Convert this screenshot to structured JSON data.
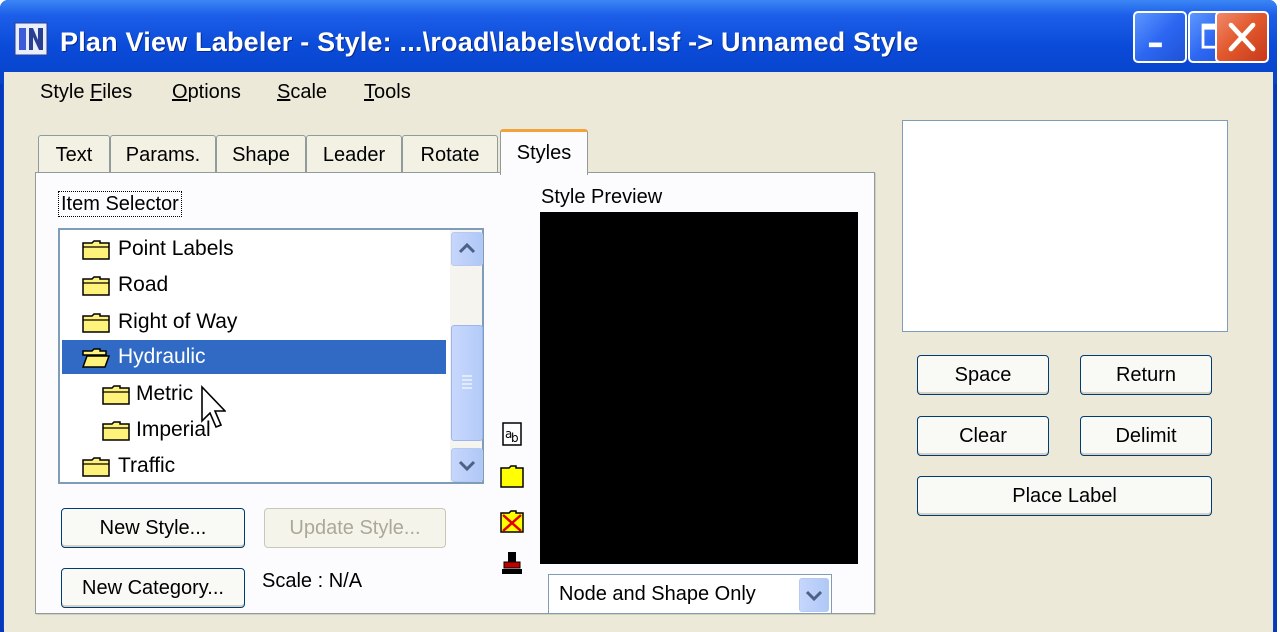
{
  "window": {
    "title": "Plan View Labeler - Style: ...\\road\\labels\\vdot.lsf -> Unnamed Style",
    "accent_color": "#0a46d6",
    "controls": [
      "minimize-icon",
      "maximize-icon",
      "close-icon"
    ]
  },
  "menu": {
    "items": [
      {
        "pre": "Style ",
        "ul": "F",
        "post": "iles"
      },
      {
        "pre": "",
        "ul": "O",
        "post": "ptions"
      },
      {
        "pre": "",
        "ul": "S",
        "post": "cale"
      },
      {
        "pre": "",
        "ul": "T",
        "post": "ools"
      }
    ]
  },
  "tabs": [
    {
      "label": "Text",
      "active": false
    },
    {
      "label": "Params.",
      "active": false
    },
    {
      "label": "Shape",
      "active": false
    },
    {
      "label": "Leader",
      "active": false
    },
    {
      "label": "Rotate",
      "active": false
    },
    {
      "label": "Styles",
      "active": true
    }
  ],
  "item_selector": {
    "label": "Item Selector",
    "items": [
      {
        "label": "Point Labels",
        "level": 0,
        "icon": "folder-icon"
      },
      {
        "label": "Road",
        "level": 0,
        "icon": "folder-icon"
      },
      {
        "label": "Right of Way",
        "level": 0,
        "icon": "folder-icon"
      },
      {
        "label": "Hydraulic",
        "level": 0,
        "icon": "folder-open-icon",
        "selected": true
      },
      {
        "label": "Metric",
        "level": 1,
        "icon": "folder-icon"
      },
      {
        "label": "Imperial",
        "level": 1,
        "icon": "folder-icon"
      },
      {
        "label": "Traffic",
        "level": 0,
        "icon": "folder-icon"
      }
    ],
    "selection_color": "#316ac5"
  },
  "buttons": {
    "new_style": "New Style...",
    "update_style": "Update Style...",
    "new_category": "New Category...",
    "space": "Space",
    "return": "Return",
    "clear": "Clear",
    "delimit": "Delimit",
    "place_label": "Place Label"
  },
  "scale_text": "Scale : N/A",
  "style_preview": {
    "label": "Style Preview",
    "mode_selected": "Node and Shape Only"
  },
  "side_icons": [
    "text-style-icon",
    "folder-icon",
    "delete-icon",
    "stamp-icon"
  ]
}
